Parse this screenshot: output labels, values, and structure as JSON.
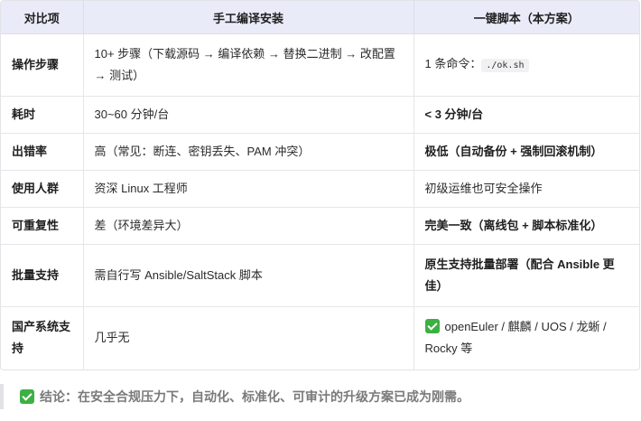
{
  "table": {
    "headers": [
      "对比项",
      "手工编译安装",
      "一键脚本（本方案）"
    ],
    "rows": [
      {
        "item": "操作步骤",
        "manual": "10+ 步骤（下载源码 → 编译依赖 → 替换二进制 → 改配置 → 测试）",
        "script_prefix": "1 条命令：",
        "script_code": "./ok.sh"
      },
      {
        "item": "耗时",
        "manual": "30~60 分钟/台",
        "script": "< 3 分钟/台"
      },
      {
        "item": "出错率",
        "manual": "高（常见：断连、密钥丢失、PAM 冲突）",
        "script": "极低（自动备份 + 强制回滚机制）"
      },
      {
        "item": "使用人群",
        "manual": "资深 Linux 工程师",
        "script": "初级运维也可安全操作"
      },
      {
        "item": "可重复性",
        "manual": "差（环境差异大）",
        "script": "完美一致（离线包 + 脚本标准化）"
      },
      {
        "item": "批量支持",
        "manual": "需自行写 Ansible/SaltStack 脚本",
        "script": "原生支持批量部署（配合 Ansible 更佳）"
      },
      {
        "item": "国产系统支持",
        "manual": "几乎无",
        "script": "openEuler / 麒麟 / UOS / 龙蜥 / Rocky 等"
      }
    ]
  },
  "conclusion": "结论：在安全合规压力下，自动化、标准化、可审计的升级方案已成为刚需。",
  "icons": {
    "check": "check-mark-icon",
    "accent": "#3cb043"
  }
}
